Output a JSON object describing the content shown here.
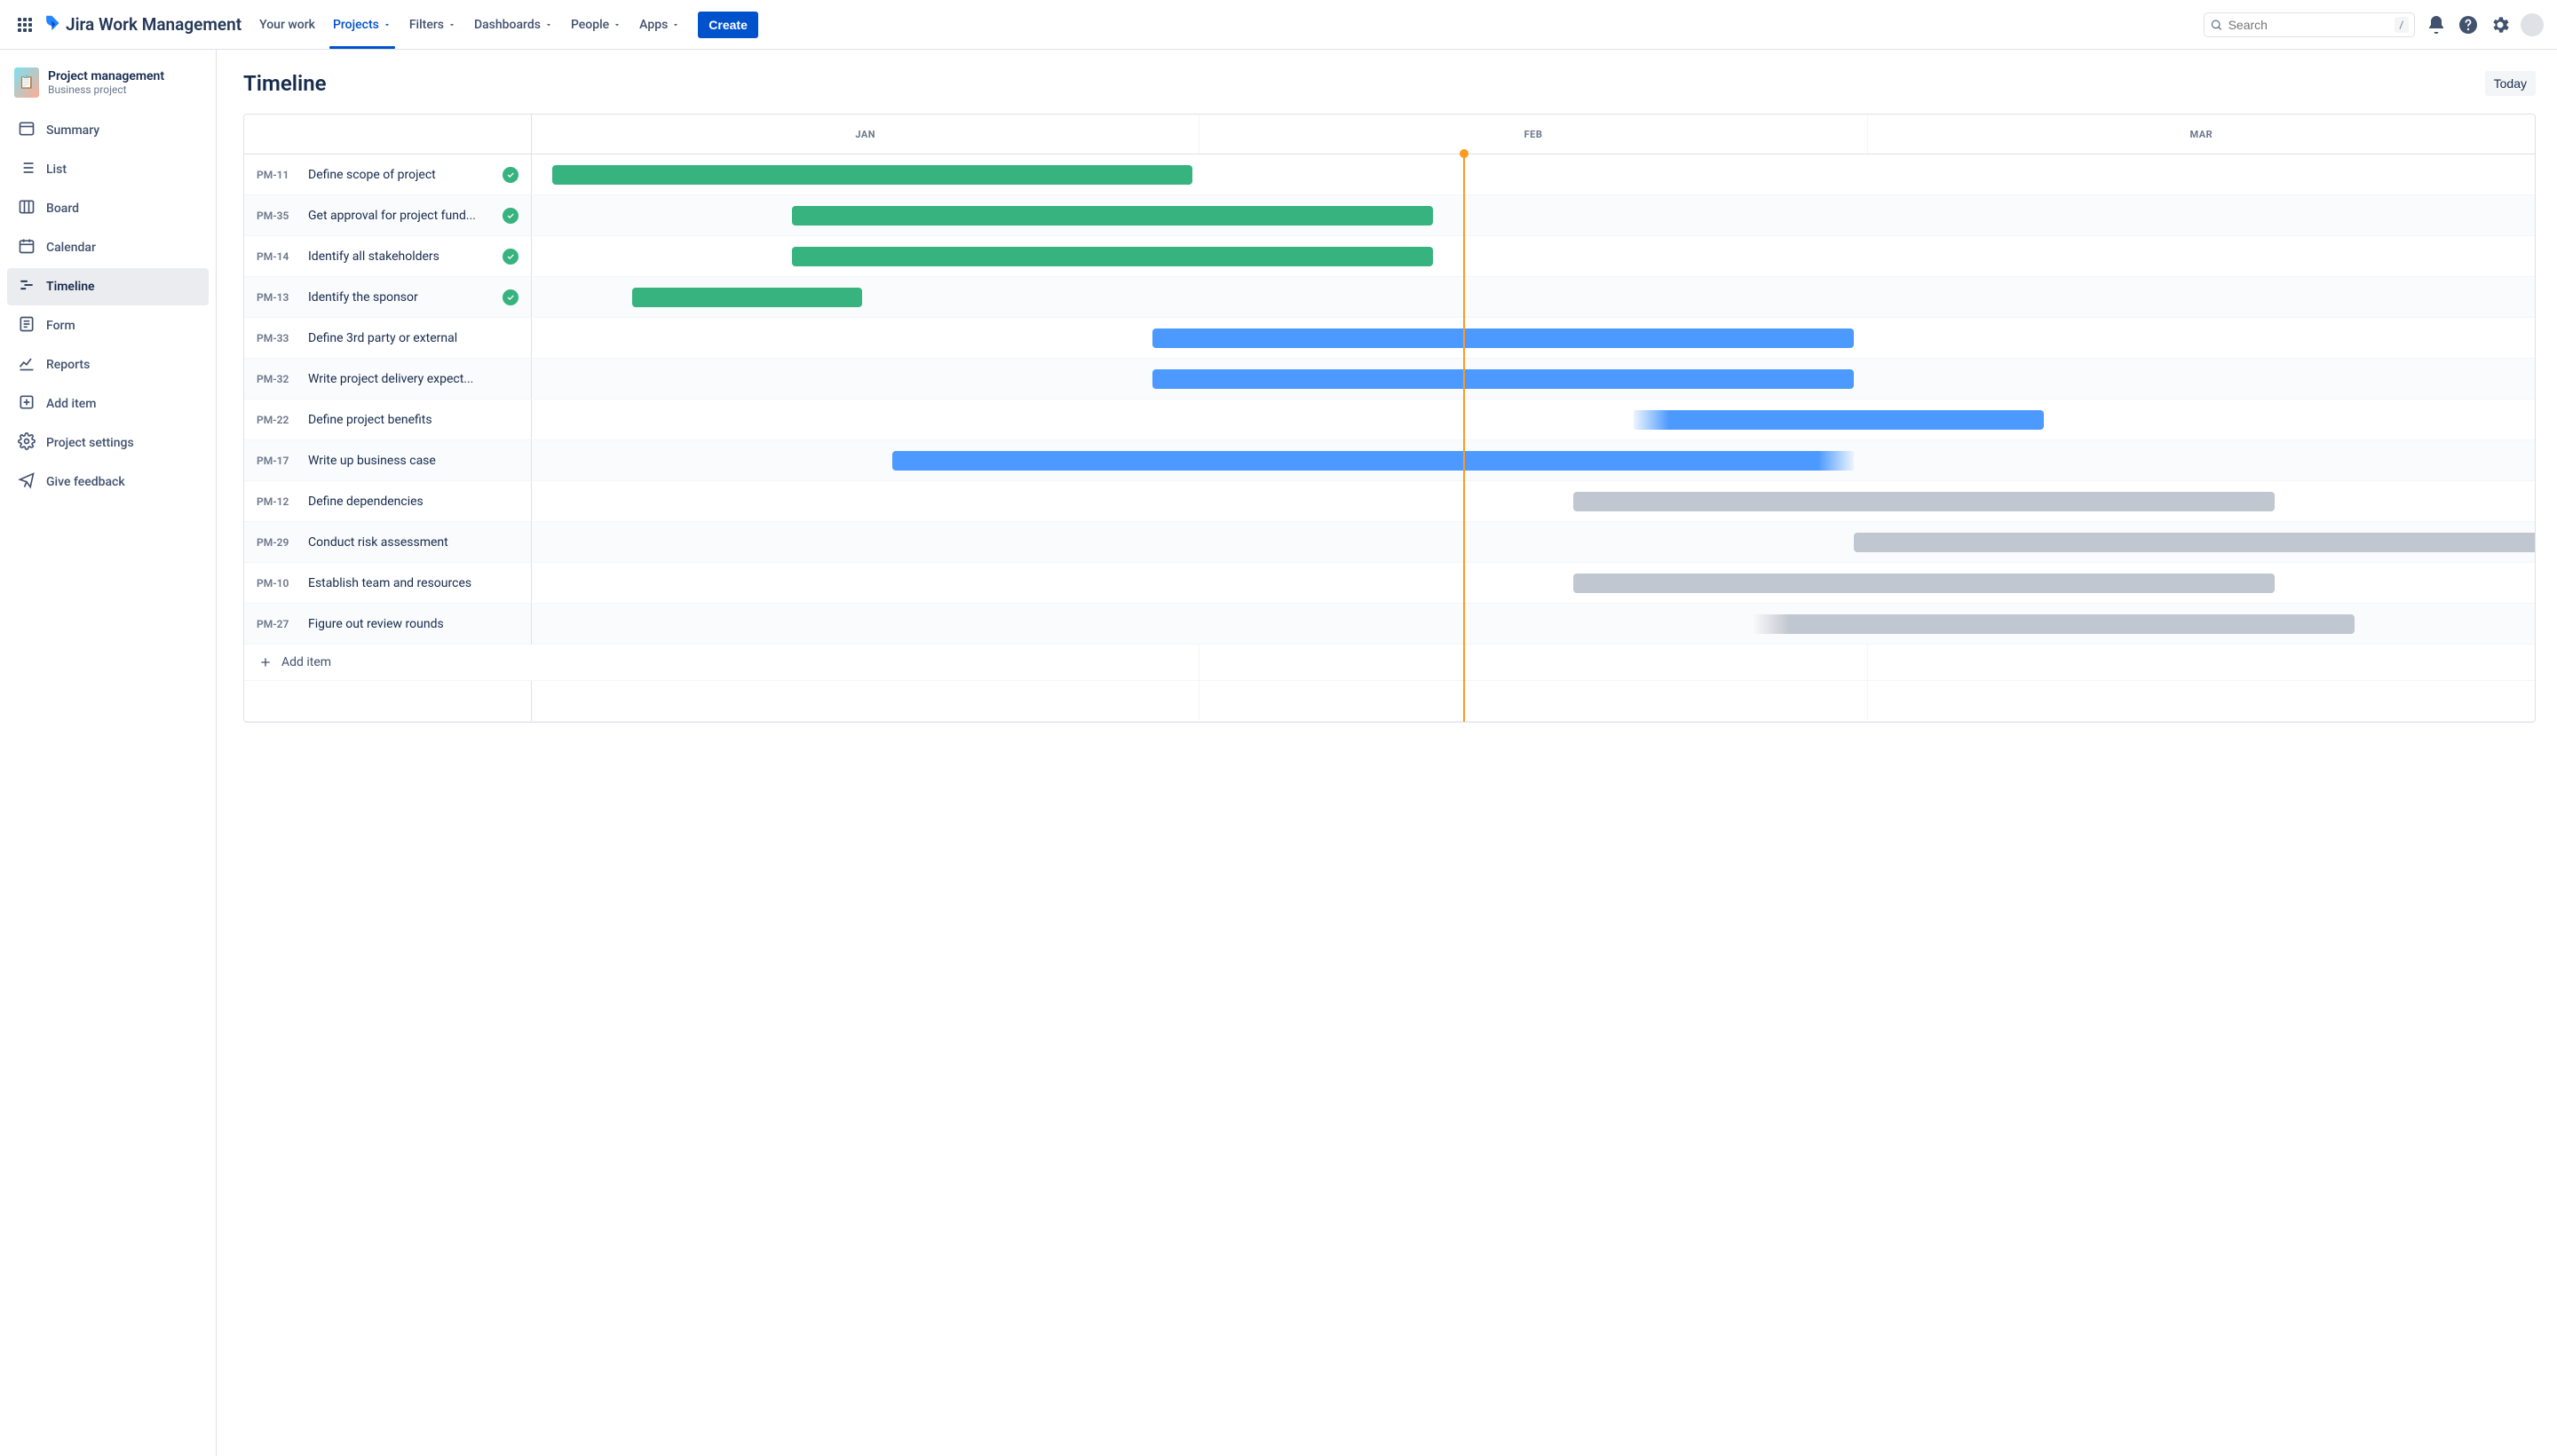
{
  "brand": {
    "name": "Jira Work Management"
  },
  "topnav": {
    "items": [
      {
        "label": "Your work",
        "selected": false,
        "chevron": false
      },
      {
        "label": "Projects",
        "selected": true,
        "chevron": true
      },
      {
        "label": "Filters",
        "selected": false,
        "chevron": true
      },
      {
        "label": "Dashboards",
        "selected": false,
        "chevron": true
      },
      {
        "label": "People",
        "selected": false,
        "chevron": true
      },
      {
        "label": "Apps",
        "selected": false,
        "chevron": true
      }
    ],
    "create_label": "Create",
    "search_placeholder": "Search",
    "search_key": "/"
  },
  "sidebar": {
    "project_title": "Project management",
    "project_subtitle": "Business project",
    "items": [
      {
        "label": "Summary",
        "icon": "layout"
      },
      {
        "label": "List",
        "icon": "list"
      },
      {
        "label": "Board",
        "icon": "board"
      },
      {
        "label": "Calendar",
        "icon": "calendar"
      },
      {
        "label": "Timeline",
        "icon": "timeline",
        "active": true
      },
      {
        "label": "Form",
        "icon": "form"
      },
      {
        "label": "Reports",
        "icon": "reports"
      },
      {
        "label": "Add item",
        "icon": "add"
      },
      {
        "label": "Project settings",
        "icon": "settings"
      },
      {
        "label": "Give feedback",
        "icon": "feedback"
      }
    ]
  },
  "main": {
    "title": "Timeline",
    "today_label": "Today",
    "months": [
      "JAN",
      "FEB",
      "MAR"
    ],
    "today_percent": 46.5,
    "add_item_label": "Add item",
    "rows": [
      {
        "key": "PM-11",
        "title": "Define scope of project",
        "done": true,
        "status": "done",
        "start_pct": 1,
        "width_pct": 32
      },
      {
        "key": "PM-35",
        "title": "Get approval for project fund...",
        "done": true,
        "status": "done",
        "start_pct": 13,
        "width_pct": 32
      },
      {
        "key": "PM-14",
        "title": "Identify all stakeholders",
        "done": true,
        "status": "done",
        "start_pct": 13,
        "width_pct": 32
      },
      {
        "key": "PM-13",
        "title": "Identify the sponsor",
        "done": true,
        "status": "done",
        "start_pct": 5,
        "width_pct": 11.5
      },
      {
        "key": "PM-33",
        "title": "Define 3rd party or external",
        "done": false,
        "status": "inprogress",
        "start_pct": 31,
        "width_pct": 35
      },
      {
        "key": "PM-32",
        "title": "Write project delivery expect...",
        "done": false,
        "status": "inprogress",
        "start_pct": 31,
        "width_pct": 35
      },
      {
        "key": "PM-22",
        "title": "Define project benefits",
        "done": false,
        "status": "inprogress",
        "start_pct": 55,
        "width_pct": 20.5,
        "fade": "left"
      },
      {
        "key": "PM-17",
        "title": "Write up business case",
        "done": false,
        "status": "inprogress",
        "start_pct": 18,
        "width_pct": 48,
        "fade": "right"
      },
      {
        "key": "PM-12",
        "title": "Define dependencies",
        "done": false,
        "status": "todo",
        "start_pct": 52,
        "width_pct": 35
      },
      {
        "key": "PM-29",
        "title": "Conduct risk assessment",
        "done": false,
        "status": "todo",
        "start_pct": 66,
        "width_pct": 35
      },
      {
        "key": "PM-10",
        "title": "Establish team and resources",
        "done": false,
        "status": "todo",
        "start_pct": 52,
        "width_pct": 35
      },
      {
        "key": "PM-27",
        "title": "Figure out review rounds",
        "done": false,
        "status": "todo",
        "start_pct": 61,
        "width_pct": 30,
        "fade": "left"
      }
    ]
  }
}
